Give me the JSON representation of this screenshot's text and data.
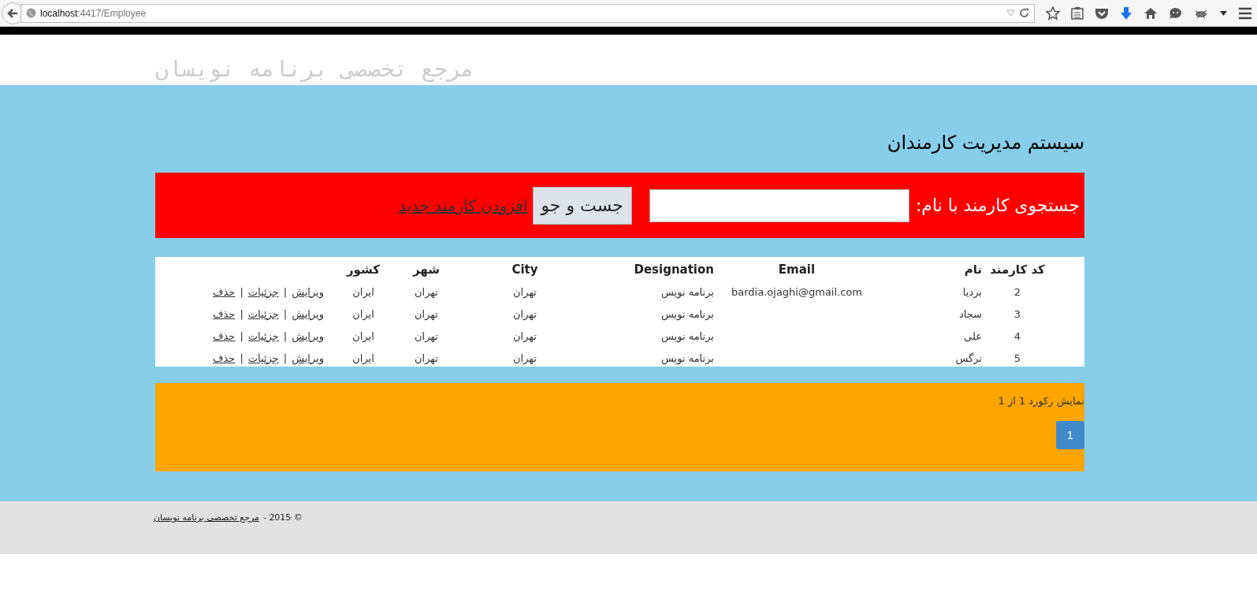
{
  "browser": {
    "url_host": "localhost",
    "url_path": ":4417/Employee"
  },
  "header": {
    "tagline": "مرجع تخصصی برنامه نویسان"
  },
  "title": "سیستم مدیریت کارمندان",
  "search": {
    "label": "جستجوی کارمند با نام:",
    "button": "جست و جو",
    "link": "افزودن کارمند جدید"
  },
  "table": {
    "columns": [
      "کد کارمند",
      "نام",
      "Email",
      "Designation",
      "City",
      "شهر",
      "کشور"
    ],
    "rows": [
      {
        "cells": [
          "2",
          "بردیا",
          "bardia.ojaghi@gmail.com",
          "برنامه نویس",
          "تهران",
          "تهران",
          "ایران"
        ],
        "actions": [
          {
            "kind": "link",
            "text": "ویرایش"
          },
          {
            "kind": "separator",
            "text": "|"
          },
          {
            "kind": "link",
            "text": "جزئیات"
          },
          {
            "kind": "separator",
            "text": "|"
          },
          {
            "kind": "link",
            "text": "حذف"
          }
        ]
      },
      {
        "cells": [
          "3",
          "سجاد",
          "",
          "برنامه نویس",
          "تهران",
          "تهران",
          "ایران"
        ],
        "actions": [
          {
            "kind": "link",
            "text": "ویرایش"
          },
          {
            "kind": "separator",
            "text": "|"
          },
          {
            "kind": "link",
            "text": "جزئیات"
          },
          {
            "kind": "separator",
            "text": "|"
          },
          {
            "kind": "link",
            "text": "حذف"
          }
        ]
      },
      {
        "cells": [
          "4",
          "علی",
          "",
          "برنامه نویس",
          "تهران",
          "تهران",
          "ایران"
        ],
        "actions": [
          {
            "kind": "link",
            "text": "ویرایش"
          },
          {
            "kind": "separator",
            "text": "|"
          },
          {
            "kind": "link",
            "text": "جزئیات"
          },
          {
            "kind": "separator",
            "text": "|"
          },
          {
            "kind": "link",
            "text": "حذف"
          }
        ]
      },
      {
        "cells": [
          "5",
          "نرگس",
          "",
          "برنامه نویس",
          "تهران",
          "تهران",
          "ایران"
        ],
        "actions": [
          {
            "kind": "link",
            "text": "ویرایش"
          },
          {
            "kind": "separator",
            "text": "|"
          },
          {
            "kind": "link",
            "text": "جزئیات"
          },
          {
            "kind": "separator",
            "text": "|"
          },
          {
            "kind": "link",
            "text": "حذف"
          }
        ]
      }
    ]
  },
  "pager": {
    "summary": "نمایش رکورد 1 از 1",
    "pages": [
      {
        "label": "1",
        "selected": true
      }
    ]
  },
  "footer": {
    "copyright": "© 2015 -",
    "link": "مرجع تخصصی برنامه نویسان"
  }
}
